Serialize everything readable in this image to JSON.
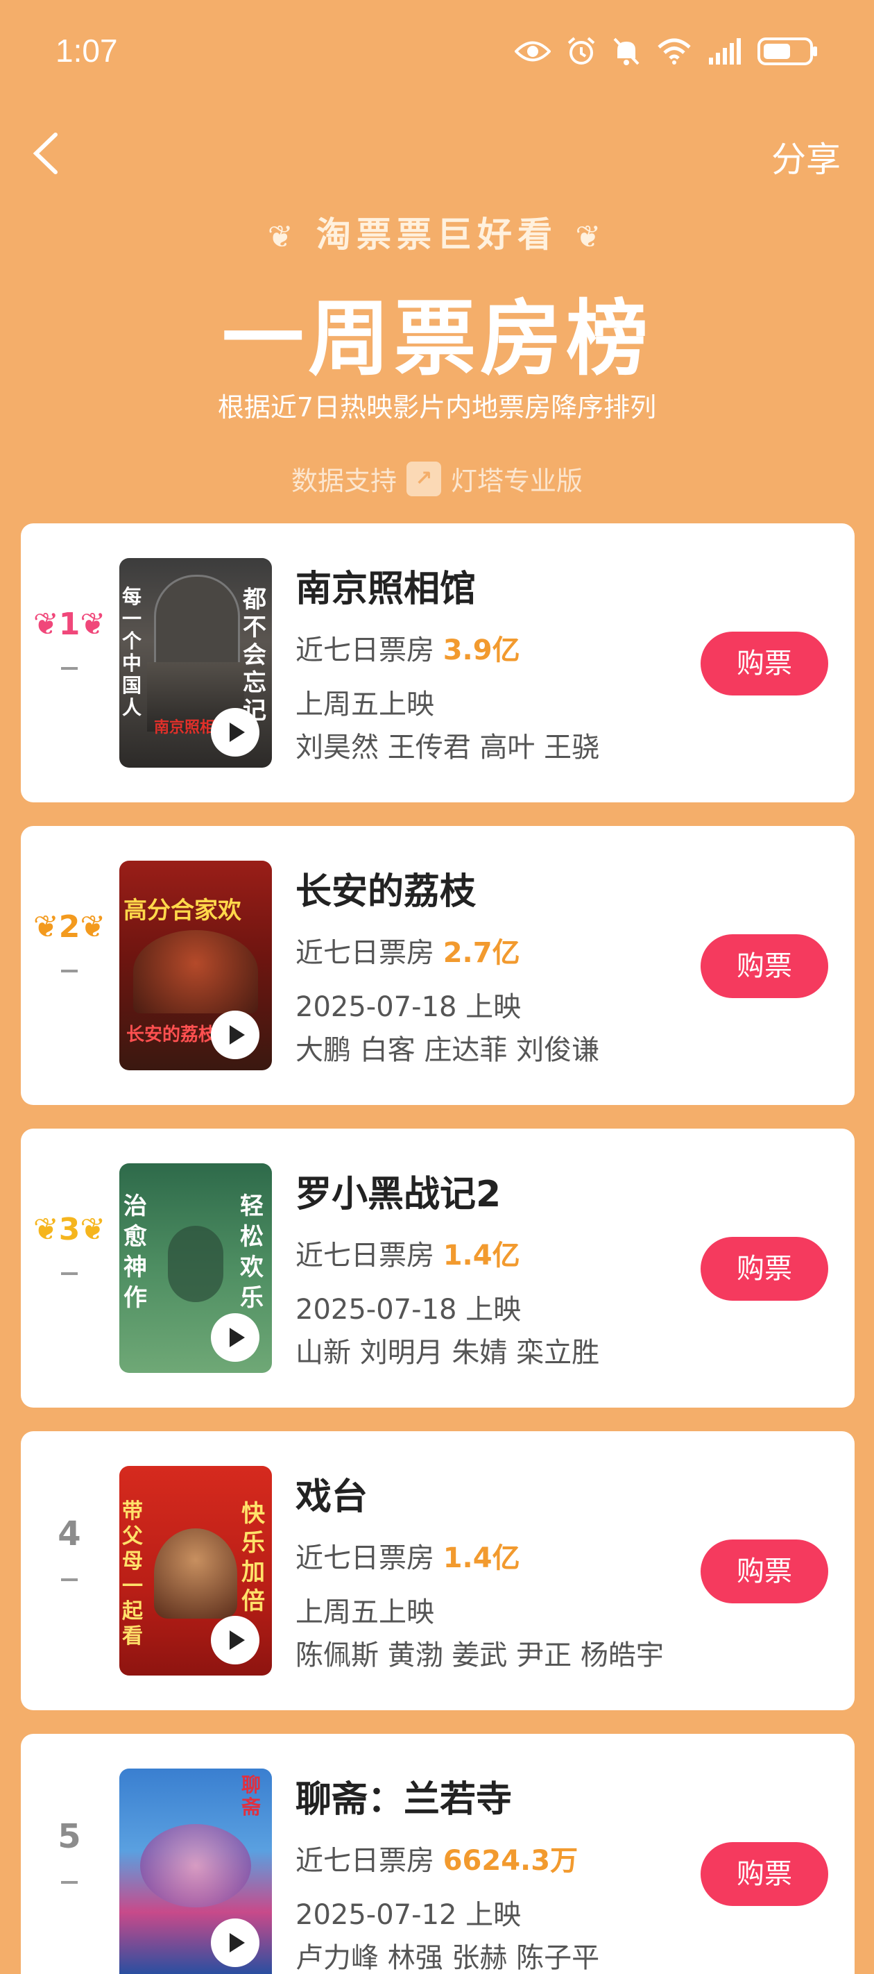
{
  "status": {
    "time": "1:07",
    "battery_icon": "battery-icon"
  },
  "nav": {
    "share": "分享"
  },
  "header": {
    "tagline": "淘票票巨好看",
    "title": "一周票房榜",
    "subtitle": "根据近7日热映影片内地票房降序排列",
    "data_support": "数据支持",
    "data_brand": "灯塔专业版"
  },
  "labels": {
    "box_office": "近七日票房",
    "buy": "购票"
  },
  "movies": [
    {
      "rank": "1",
      "title": "南京照相馆",
      "box_office": "3.9亿",
      "release": "上周五上映",
      "cast": "刘昊然 王传君 高叶 王骁"
    },
    {
      "rank": "2",
      "title": "长安的荔枝",
      "box_office": "2.7亿",
      "release": "2025-07-18 上映",
      "cast": "大鹏 白客 庄达菲 刘俊谦"
    },
    {
      "rank": "3",
      "title": "罗小黑战记2",
      "box_office": "1.4亿",
      "release": "2025-07-18 上映",
      "cast": "山新 刘明月 朱婧 栾立胜"
    },
    {
      "rank": "4",
      "title": "戏台",
      "box_office": "1.4亿",
      "release": "上周五上映",
      "cast": "陈佩斯 黄渤 姜武 尹正 杨皓宇"
    },
    {
      "rank": "5",
      "title": "聊斋：兰若寺",
      "box_office": "6624.3万",
      "release": "2025-07-12 上映",
      "cast": "卢力峰 林强 张赫 陈子平"
    }
  ],
  "posters": [
    {
      "left": "每一个中国人",
      "right": "都不会忘记",
      "bottom": "南京照相馆"
    },
    {
      "top": "高分合家欢",
      "bottom": "长安的荔枝"
    },
    {
      "left": "治愈神作",
      "right": "轻松欢乐"
    },
    {
      "left": "带父母一起看",
      "right": "快乐加倍"
    },
    {
      "top": "聊斋"
    }
  ],
  "colors": {
    "background": "#F4AE6A",
    "accent_price": "#F29A2E",
    "buy_button": "#F53A5E",
    "rank1": "#F0477A",
    "rank2": "#F39A1E",
    "rank3": "#F5B51E",
    "rank_other": "#8C8C8C"
  }
}
